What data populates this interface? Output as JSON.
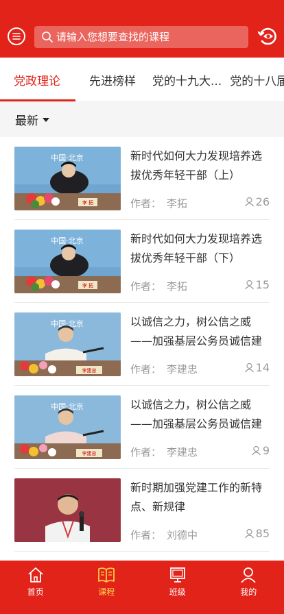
{
  "header": {
    "search_placeholder": "请输入您想要查找的课程",
    "menu_icon": "menu-icon",
    "history_icon": "refresh-eye-icon",
    "brand_color": "#e2231a"
  },
  "tabs": [
    {
      "label": "党政理论",
      "active": true
    },
    {
      "label": "先进榜样"
    },
    {
      "label": "党的十九大..."
    },
    {
      "label": "党的十八届"
    }
  ],
  "sort": {
    "label": "最新"
  },
  "items": [
    {
      "title": "新时代如何大力发现培养选拔优秀年轻干部（上）",
      "author_prefix": "作者：",
      "author": "李拓",
      "views": "26",
      "banner": "中国·北京",
      "nameplate": "李 拓"
    },
    {
      "title": "新时代如何大力发现培养选拔优秀年轻干部（下）",
      "author_prefix": "作者：",
      "author": "李拓",
      "views": "15",
      "banner": "中国·北京",
      "nameplate": "李 拓"
    },
    {
      "title": "以诚信之力，树公信之威——加强基层公务员诚信建设...",
      "author_prefix": "作者：",
      "author": "李建忠",
      "views": "14",
      "banner": "中国·北京",
      "nameplate": "李建忠"
    },
    {
      "title": "以诚信之力，树公信之威——加强基层公务员诚信建设...",
      "author_prefix": "作者：",
      "author": "李建忠",
      "views": "9",
      "banner": "中国·北京",
      "nameplate": "李建忠"
    },
    {
      "title": "新时期加强党建工作的新特点、新规律",
      "author_prefix": "作者：",
      "author": "刘德中",
      "views": "85"
    }
  ],
  "nav": [
    {
      "label": "首页",
      "icon": "home-icon"
    },
    {
      "label": "课程",
      "icon": "book-icon",
      "active": true
    },
    {
      "label": "班级",
      "icon": "monitor-icon"
    },
    {
      "label": "我的",
      "icon": "user-icon"
    }
  ]
}
